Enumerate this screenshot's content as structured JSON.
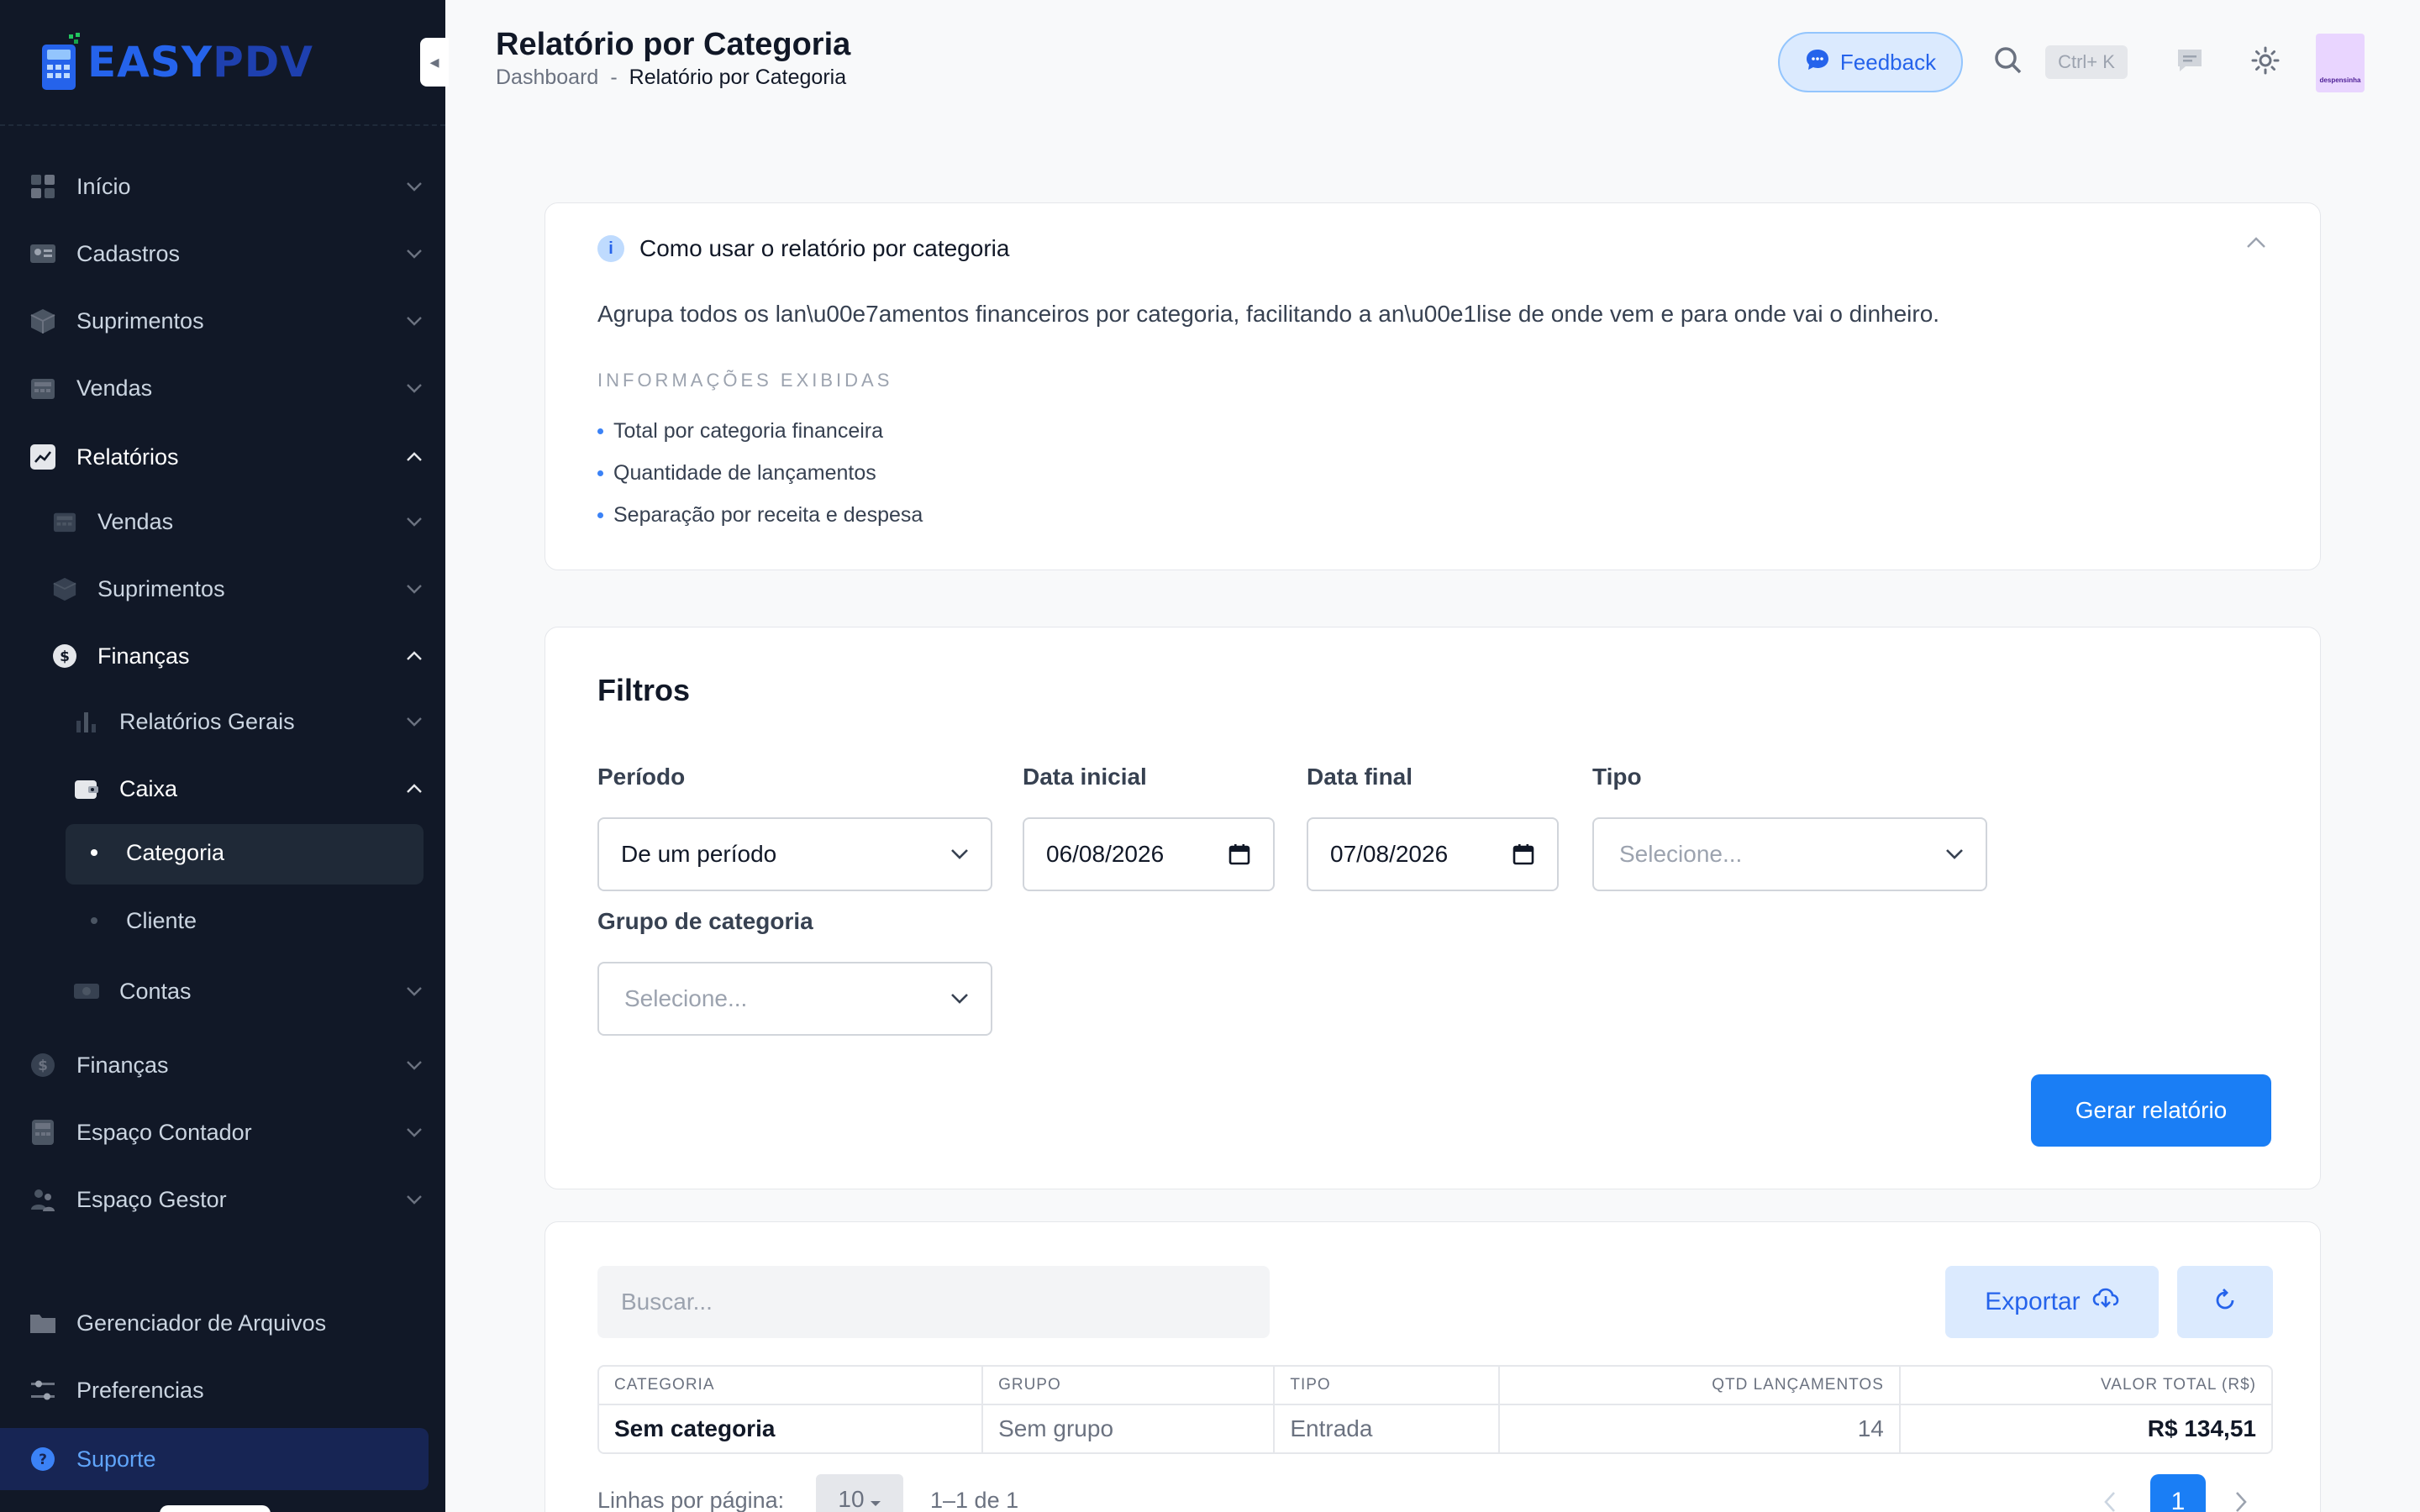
{
  "brand": {
    "name_part1": "EASY",
    "name_part2": "PDV"
  },
  "sidebar": {
    "items": [
      {
        "label": "Início"
      },
      {
        "label": "Cadastros"
      },
      {
        "label": "Suprimentos"
      },
      {
        "label": "Vendas"
      },
      {
        "label": "Relatórios"
      },
      {
        "label": "Vendas"
      },
      {
        "label": "Suprimentos"
      },
      {
        "label": "Finanças"
      },
      {
        "label": "Relatórios Gerais"
      },
      {
        "label": "Caixa"
      },
      {
        "label": "Categoria"
      },
      {
        "label": "Cliente"
      },
      {
        "label": "Contas"
      },
      {
        "label": "Finanças"
      },
      {
        "label": "Espaço Contador"
      },
      {
        "label": "Espaço Gestor"
      },
      {
        "label": "Gerenciador de Arquivos"
      },
      {
        "label": "Preferencias"
      },
      {
        "label": "Suporte"
      }
    ]
  },
  "header": {
    "title": "Relatório por Categoria",
    "breadcrumb": {
      "home": "Dashboard",
      "sep": "-",
      "current": "Relatório por Categoria"
    },
    "feedback_label": "Feedback",
    "search_shortcut": "Ctrl+ K",
    "avatar_text": "despensinha"
  },
  "info": {
    "title": "Como usar o relatório por categoria",
    "description": "Agrupa todos os lan\\u00e7amentos financeiros por categoria, facilitando a an\\u00e1lise de onde vem e para onde vai o dinheiro.",
    "section_label": "INFORMAÇÕES EXIBIDAS",
    "list": [
      "Total por categoria financeira",
      "Quantidade de lançamentos",
      "Separação por receita e despesa"
    ]
  },
  "filters": {
    "title": "Filtros",
    "periodo_label": "Período",
    "periodo_value": "De um período",
    "data_inicial_label": "Data inicial",
    "data_inicial_value": "06/08/2026",
    "data_final_label": "Data final",
    "data_final_value": "07/08/2026",
    "tipo_label": "Tipo",
    "tipo_placeholder": "Selecione...",
    "grupo_label": "Grupo de categoria",
    "grupo_placeholder": "Selecione...",
    "submit_label": "Gerar relatório"
  },
  "table": {
    "search_placeholder": "Buscar...",
    "export_label": "Exportar",
    "columns": [
      "CATEGORIA",
      "GRUPO",
      "TIPO",
      "QTD LANÇAMENTOS",
      "VALOR TOTAL (R$)"
    ],
    "rows": [
      {
        "categoria": "Sem categoria",
        "grupo": "Sem grupo",
        "tipo": "Entrada",
        "qtd": "14",
        "valor": "R$ 134,51"
      }
    ],
    "rows_per_page_label": "Linhas por página:",
    "rows_per_page_value": "10",
    "range_text": "1–1 de 1",
    "current_page": "1"
  },
  "colors": {
    "accent": "#1a7ef5",
    "sidebar_bg": "#111827",
    "feedback_bg": "#dbeafe"
  }
}
